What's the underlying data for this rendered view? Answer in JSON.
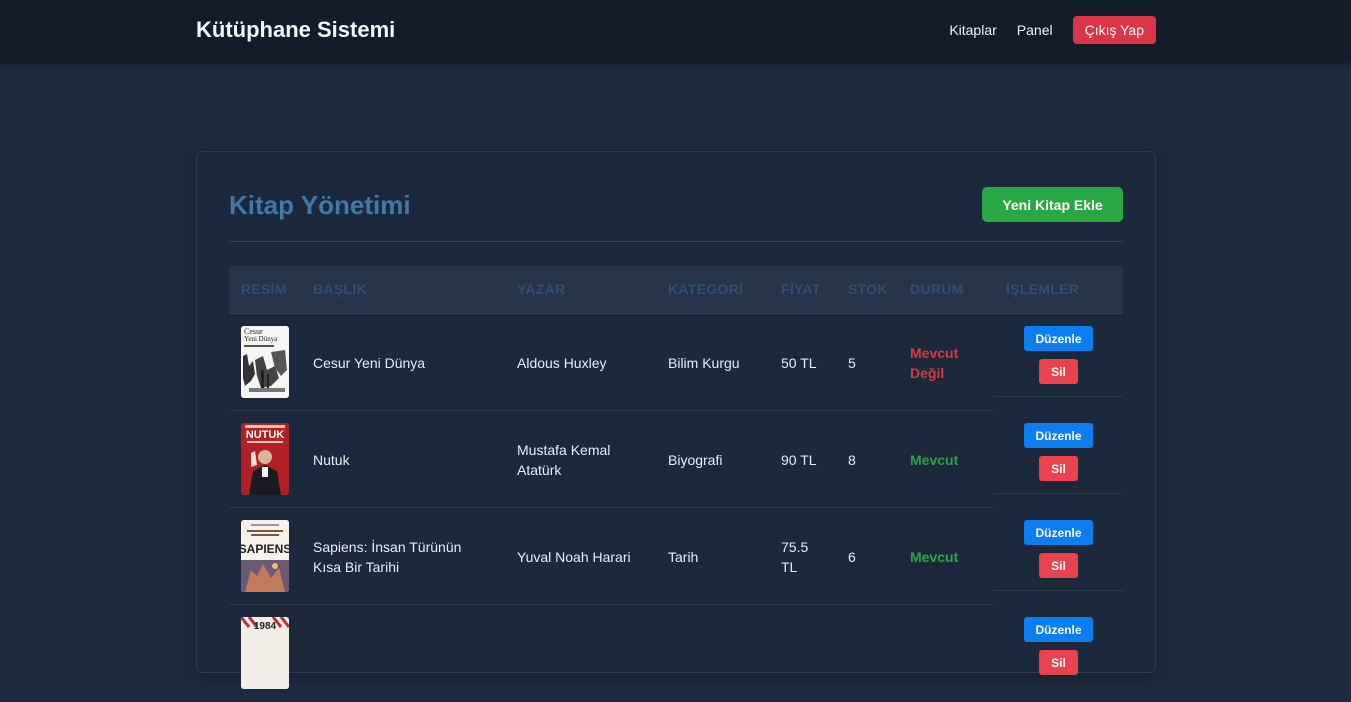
{
  "navbar": {
    "brand": "Kütüphane Sistemi",
    "links": [
      "Kitaplar",
      "Panel"
    ],
    "logout_label": "Çıkış Yap"
  },
  "main": {
    "title": "Kitap Yönetimi",
    "add_button_label": "Yeni Kitap Ekle",
    "columns": [
      "RESİM",
      "BAŞLIK",
      "YAZAR",
      "KATEGORİ",
      "FİYAT",
      "STOK",
      "DURUM",
      "İŞLEMLER"
    ],
    "rows": [
      {
        "title": "Cesur Yeni Dünya",
        "author": "Aldous Huxley",
        "category": "Bilim Kurgu",
        "price": "50 TL",
        "stock": "5",
        "status": "Mevcut Değil",
        "available": false,
        "cover_text": [
          "Cesur",
          "Yeni Dünya"
        ]
      },
      {
        "title": "Nutuk",
        "author": "Mustafa Kemal Atatürk",
        "category": "Biyografi",
        "price": "90 TL",
        "stock": "8",
        "status": "Mevcut",
        "available": true,
        "cover_text": [
          "NUTUK"
        ]
      },
      {
        "title": "Sapiens: İnsan Türünün Kısa Bir Tarihi",
        "author": "Yuval Noah Harari",
        "category": "Tarih",
        "price": "75.5 TL",
        "stock": "6",
        "status": "Mevcut",
        "available": true,
        "cover_text": [
          "SAPIENS"
        ]
      },
      {
        "title": "",
        "author": "",
        "category": "",
        "price": "",
        "stock": "",
        "status": "",
        "available": true,
        "cover_text": [
          "1984"
        ]
      }
    ],
    "edit_label": "Düzenle",
    "delete_label": "Sil"
  },
  "colors": {
    "background": "#1e2a3f",
    "navbar": "#131c2b",
    "title_accent": "#3f7aa8",
    "success": "#28a745",
    "danger": "#dc3545",
    "primary": "#0d7ef0"
  }
}
